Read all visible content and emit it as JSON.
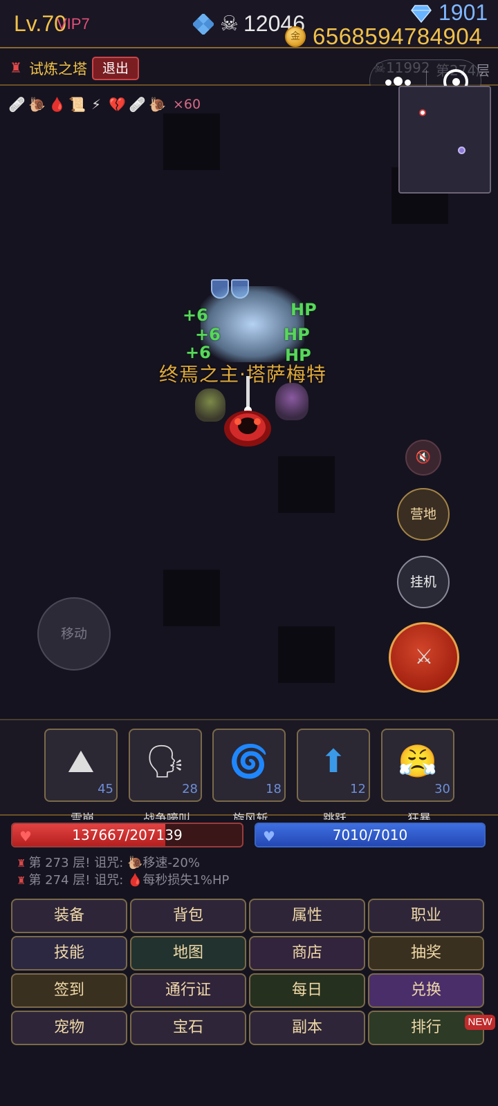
{
  "header": {
    "level": "Lv.70",
    "vip": "VIP7",
    "skull_count": "12046",
    "gem_count": "1901",
    "gold_count": "6568594784904",
    "colors": {
      "gold": "#f1c24a",
      "gem": "#7fb7ff",
      "vip": "#e2507a"
    }
  },
  "location": {
    "tower_name": "试炼之塔",
    "exit_label": "退出",
    "kill_count": "11992",
    "floor": "第274层"
  },
  "buffs": {
    "icons": [
      "bandage-icon",
      "snail-icon",
      "blood-drop-icon",
      "scroll-icon",
      "lightning-icon",
      "broken-heart-icon",
      "bandage-icon",
      "snail-icon"
    ],
    "glyphs": [
      "🩹",
      "🐌",
      "🩸",
      "📜",
      "⚡",
      "💔",
      "🩹",
      "🐌"
    ],
    "multiplier": "×60"
  },
  "battle": {
    "boss_name": "终焉之主·塔萨梅特",
    "heal_texts": [
      "+6",
      "HP",
      "+6",
      "HP",
      "+6",
      "HP"
    ]
  },
  "controls": {
    "move_label": "移动",
    "camp_label": "营地",
    "idle_label": "挂机",
    "mute_icon": "mute-icon",
    "attack_icon": "crossed-swords-icon"
  },
  "skills": [
    {
      "name": "雪崩",
      "level": "45",
      "icon": "mountain-icon",
      "glyph": "⛰"
    },
    {
      "name": "战争嚎叫",
      "level": "28",
      "icon": "shout-icon",
      "glyph": "🗣"
    },
    {
      "name": "旋风斩",
      "level": "18",
      "icon": "cyclone-icon",
      "glyph": "🌀"
    },
    {
      "name": "跳跃",
      "level": "12",
      "icon": "up-arrow-icon",
      "glyph": "⬆"
    },
    {
      "name": "狂暴",
      "level": "30",
      "icon": "angry-face-icon",
      "glyph": "😤"
    }
  ],
  "status": {
    "hp_text": "137667/207139",
    "hp_fraction": 0.665,
    "mp_text": "7010/7010",
    "mp_fraction": 1.0
  },
  "log": [
    {
      "prefix": "第 273 层! 诅咒:",
      "icon": "snail-icon",
      "glyph": "🐌",
      "effect": "移速-20%"
    },
    {
      "prefix": "第 274 层! 诅咒:",
      "icon": "blood-drop-icon",
      "glyph": "🩸",
      "effect": "每秒损失1%HP"
    }
  ],
  "menu": [
    {
      "label": "装备",
      "bg": "#2e2638"
    },
    {
      "label": "背包",
      "bg": "#2e2638"
    },
    {
      "label": "属性",
      "bg": "#2e2638"
    },
    {
      "label": "职业",
      "bg": "#2e2638"
    },
    {
      "label": "技能",
      "bg": "#2c2842"
    },
    {
      "label": "地图",
      "bg": "#22322e"
    },
    {
      "label": "商店",
      "bg": "#32243c"
    },
    {
      "label": "抽奖",
      "bg": "#3a3020"
    },
    {
      "label": "签到",
      "bg": "#3a3020"
    },
    {
      "label": "通行证",
      "bg": "#30243a"
    },
    {
      "label": "每日",
      "bg": "#26301e"
    },
    {
      "label": "兑换",
      "bg": "#4a2e6a"
    },
    {
      "label": "宠物",
      "bg": "#2e2638"
    },
    {
      "label": "宝石",
      "bg": "#2e2638"
    },
    {
      "label": "副本",
      "bg": "#2e2638"
    },
    {
      "label": "排行",
      "bg": "#2c3a26"
    }
  ],
  "new_badge": "NEW"
}
